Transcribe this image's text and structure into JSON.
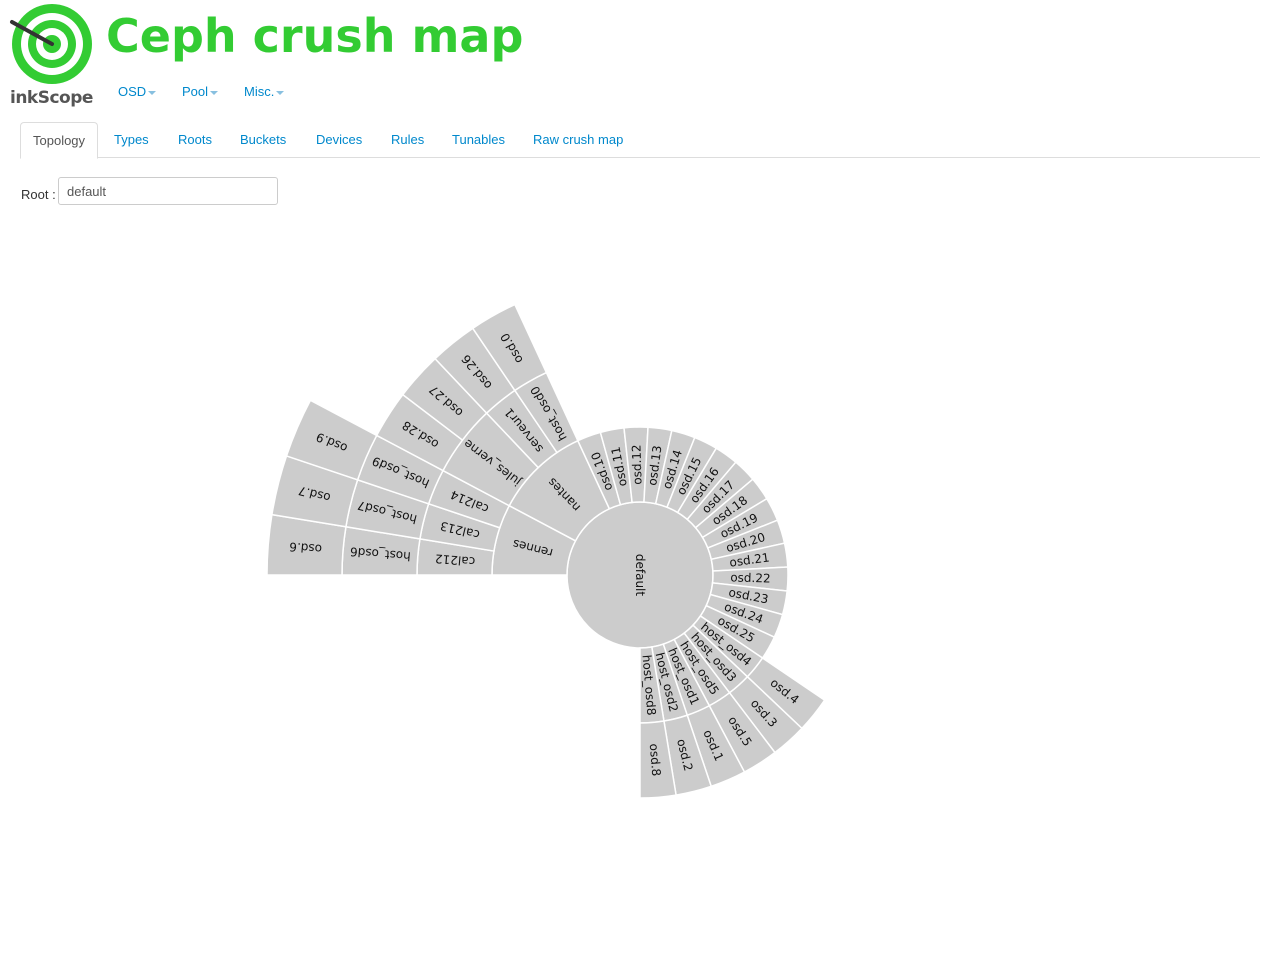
{
  "brand": {
    "logo_text": "inkScope",
    "title": "Ceph crush map",
    "accent_color": "#33cc33",
    "logo_icon": "target-icon"
  },
  "menu": [
    {
      "label": "OSD"
    },
    {
      "label": "Pool"
    },
    {
      "label": "Misc."
    }
  ],
  "tabs": [
    {
      "label": "Topology",
      "active": true
    },
    {
      "label": "Types"
    },
    {
      "label": "Roots"
    },
    {
      "label": "Buckets"
    },
    {
      "label": "Devices"
    },
    {
      "label": "Rules"
    },
    {
      "label": "Tunables"
    },
    {
      "label": "Raw crush map"
    }
  ],
  "root_selector": {
    "label": "Root :",
    "value": "default"
  },
  "topology": {
    "type": "sunburst",
    "root": "default",
    "children": [
      {
        "name": "rennes",
        "children": [
          {
            "name": "cal212",
            "children": [
              {
                "name": "host_osd6",
                "children": [
                  {
                    "name": "osd.6"
                  }
                ]
              }
            ]
          },
          {
            "name": "cal213",
            "children": [
              {
                "name": "host_osd7",
                "children": [
                  {
                    "name": "osd.7"
                  }
                ]
              }
            ]
          },
          {
            "name": "cal214",
            "children": [
              {
                "name": "host_osd9",
                "children": [
                  {
                    "name": "osd.9"
                  }
                ]
              }
            ]
          }
        ]
      },
      {
        "name": "nantes",
        "children": [
          {
            "name": "jules_verne",
            "children": [
              {
                "name": "osd.28"
              },
              {
                "name": "osd.27"
              }
            ]
          },
          {
            "name": "serveur1",
            "children": [
              {
                "name": "osd.26"
              }
            ]
          },
          {
            "name": "host_osd0",
            "children": [
              {
                "name": "osd.0"
              }
            ]
          }
        ]
      },
      {
        "name": "osd.10"
      },
      {
        "name": "osd.11"
      },
      {
        "name": "osd.12"
      },
      {
        "name": "osd.13"
      },
      {
        "name": "osd.14"
      },
      {
        "name": "osd.15"
      },
      {
        "name": "osd.16"
      },
      {
        "name": "osd.17"
      },
      {
        "name": "osd.18"
      },
      {
        "name": "osd.19"
      },
      {
        "name": "osd.20"
      },
      {
        "name": "osd.21"
      },
      {
        "name": "osd.22"
      },
      {
        "name": "osd.23"
      },
      {
        "name": "osd.24"
      },
      {
        "name": "osd.25"
      },
      {
        "name": "host_osd4",
        "children": [
          {
            "name": "osd.4"
          }
        ]
      },
      {
        "name": "host_osd3",
        "children": [
          {
            "name": "osd.3"
          }
        ]
      },
      {
        "name": "host_osd5",
        "children": [
          {
            "name": "osd.5"
          }
        ]
      },
      {
        "name": "host_osd1",
        "children": [
          {
            "name": "osd.1"
          }
        ]
      },
      {
        "name": "host_osd2",
        "children": [
          {
            "name": "osd.2"
          }
        ]
      },
      {
        "name": "host_osd8",
        "children": [
          {
            "name": "osd.8"
          }
        ]
      }
    ],
    "fill_color": "#cccccc",
    "stroke_color": "#ffffff"
  }
}
